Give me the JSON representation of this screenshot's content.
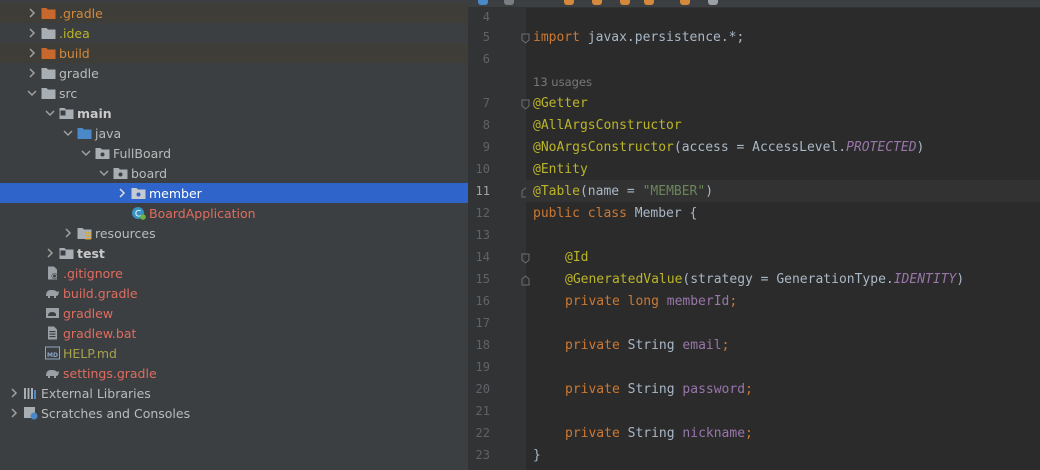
{
  "project_tree": {
    "items": [
      {
        "label": ".gradle",
        "icon": "folder-excluded-icon",
        "expanded": false
      },
      {
        "label": ".idea",
        "icon": "folder-icon",
        "expanded": false
      },
      {
        "label": "build",
        "icon": "folder-excluded-icon",
        "expanded": false
      },
      {
        "label": "gradle",
        "icon": "folder-icon",
        "expanded": false
      },
      {
        "label": "src",
        "icon": "folder-icon",
        "expanded": true
      },
      {
        "label": "main",
        "icon": "source-root-folder-icon",
        "expanded": true
      },
      {
        "label": "java",
        "icon": "java-source-folder-icon",
        "expanded": true
      },
      {
        "label": "FullBoard",
        "icon": "package-icon",
        "expanded": true
      },
      {
        "label": "board",
        "icon": "package-icon",
        "expanded": true
      },
      {
        "label": "member",
        "icon": "package-icon",
        "expanded": false
      },
      {
        "label": "BoardApplication",
        "icon": "spring-boot-class-icon"
      },
      {
        "label": "resources",
        "icon": "resources-folder-icon",
        "expanded": false
      },
      {
        "label": "test",
        "icon": "test-folder-icon",
        "expanded": false
      },
      {
        "label": ".gitignore",
        "icon": "gitignore-file-icon"
      },
      {
        "label": "build.gradle",
        "icon": "gradle-elephant-icon"
      },
      {
        "label": "gradlew",
        "icon": "gradle-file-icon"
      },
      {
        "label": "gradlew.bat",
        "icon": "bat-file-icon"
      },
      {
        "label": "HELP.md",
        "icon": "markdown-file-icon"
      },
      {
        "label": "settings.gradle",
        "icon": "gradle-elephant-icon"
      },
      {
        "label": "External Libraries",
        "icon": "libraries-icon",
        "expanded": false
      },
      {
        "label": "Scratches and Consoles",
        "icon": "scratches-icon",
        "expanded": false
      }
    ],
    "selected": "member"
  },
  "editor": {
    "current_line": "11",
    "usages_hint": "13 usages",
    "line_numbers": [
      "4",
      "5",
      "6",
      "7",
      "8",
      "9",
      "10",
      "11",
      "12",
      "13",
      "14",
      "15",
      "16",
      "17",
      "18",
      "19",
      "20",
      "21",
      "22",
      "23"
    ],
    "code": {
      "l5_kw": "import",
      "l5_rest": " javax.persistence.*;",
      "l7_ann": "@Getter",
      "l8_ann": "@AllArgsConstructor",
      "l9_ann": "@NoArgsConstructor",
      "l9_a": "(access = AccessLevel.",
      "l9_const": "PROTECTED",
      "l9_b": ")",
      "l10_ann": "@Entity",
      "l11_ann": "@Table",
      "l11_a": "(name = ",
      "l11_str": "\"MEMBER\"",
      "l11_b": ")",
      "l12_kw": "public class",
      "l12_rest": " Member {",
      "l14_ann": "@Id",
      "l15_ann": "@GeneratedValue",
      "l15_a": "(strategy = GenerationType.",
      "l15_const": "IDENTITY",
      "l15_b": ")",
      "l16_kw": "private long",
      "l16_fld": "memberId",
      "l16_end": ";",
      "l18_kw": "private",
      "l18_type": " String ",
      "l18_fld": "email",
      "l18_end": ";",
      "l20_kw": "private",
      "l20_type": " String ",
      "l20_fld": "password",
      "l20_end": ";",
      "l22_kw": "private",
      "l22_type": " String ",
      "l22_fld": "nickname",
      "l22_end": ";",
      "l23": "}"
    }
  },
  "colors": {
    "tree_bg": "#3c3f41",
    "selection": "#2f65ca",
    "editor_bg": "#2b2b2b",
    "keyword": "#cc7832",
    "annotation": "#bbb529",
    "string": "#6a8759",
    "field": "#9876aa"
  }
}
